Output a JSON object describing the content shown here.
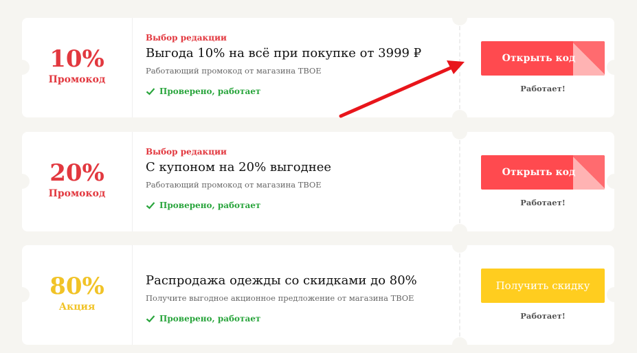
{
  "offers": [
    {
      "discount": "10%",
      "kind": "Промокод",
      "editor_badge": "Выбор редакции",
      "title": "Выгода 10% на всё при покупке от 3999 ₽",
      "description": "Работающий промокод от магазина ТВОЕ",
      "verified": "Проверено, работает",
      "button_label": "Открыть код",
      "status": "Работает!"
    },
    {
      "discount": "20%",
      "kind": "Промокод",
      "editor_badge": "Выбор редакции",
      "title": "С купоном на 20% выгоднее",
      "description": "Работающий промокод от магазина ТВОЕ",
      "verified": "Проверено, работает",
      "button_label": "Открыть код",
      "status": "Работает!"
    },
    {
      "discount": "80%",
      "kind": "Акция",
      "title": "Распродажа одежды со скидками до 80%",
      "description": "Получите выгодное акционное предложение от магазина ТВОЕ",
      "verified": "Проверено, работает",
      "button_label": "Получить скидку",
      "status": "Работает!"
    }
  ],
  "colors": {
    "promo_red": "#e2383f",
    "action_yellow": "#f1c327",
    "verified_green": "#2aa53d",
    "button_red": "#ff4a4f",
    "button_yellow": "#ffcd1f",
    "arrow_red": "#e8151b"
  }
}
